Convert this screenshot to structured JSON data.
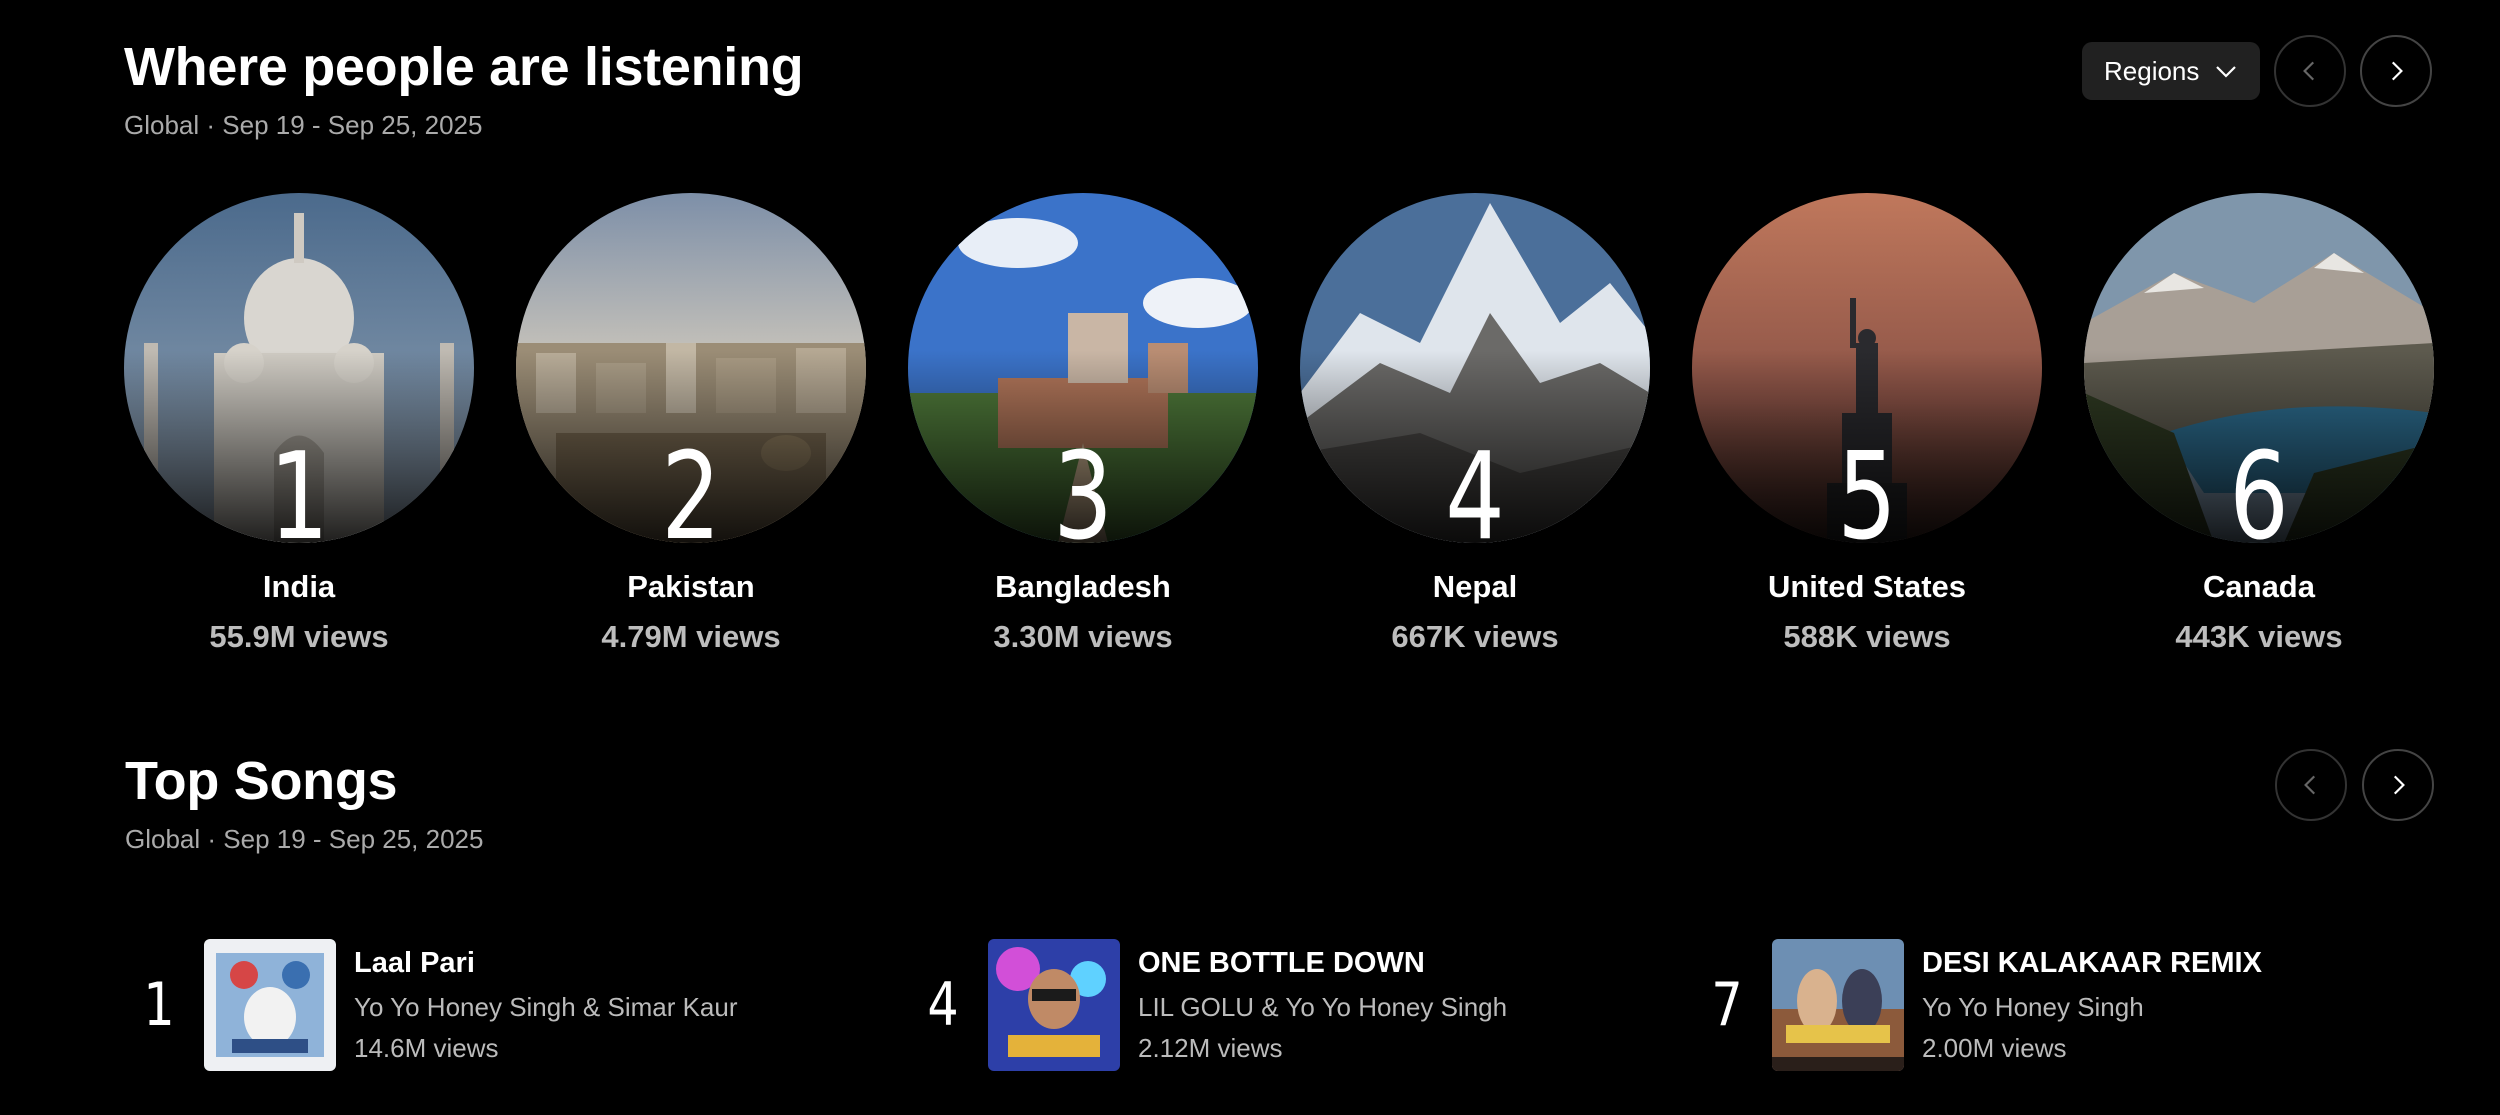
{
  "regions_section": {
    "title": "Where people are listening",
    "subtitle": "Global · Sep 19 - Sep 25, 2025",
    "dropdown_label": "Regions",
    "items": [
      {
        "rank": "1",
        "name": "India",
        "views": "55.9M views",
        "icon": "taj-mahal-photo"
      },
      {
        "rank": "2",
        "name": "Pakistan",
        "views": "4.79M views",
        "icon": "city-skyline-photo"
      },
      {
        "rank": "3",
        "name": "Bangladesh",
        "views": "3.30M views",
        "icon": "fort-photo"
      },
      {
        "rank": "4",
        "name": "Nepal",
        "views": "667K views",
        "icon": "mountain-photo"
      },
      {
        "rank": "5",
        "name": "United States",
        "views": "588K views",
        "icon": "statue-of-liberty-photo"
      },
      {
        "rank": "6",
        "name": "Canada",
        "views": "443K views",
        "icon": "lake-mountains-photo"
      }
    ]
  },
  "songs_section": {
    "title": "Top Songs",
    "subtitle": "Global · Sep 19 - Sep 25, 2025",
    "items": [
      {
        "rank": "1",
        "title": "Laal Pari",
        "artist": "Yo Yo Honey Singh & Simar Kaur",
        "views": "14.6M views"
      },
      {
        "rank": "4",
        "title": "ONE BOTTLE DOWN",
        "artist": "LIL GOLU & Yo Yo Honey Singh",
        "views": "2.12M views"
      },
      {
        "rank": "7",
        "title": "DESI KALAKAAR REMIX",
        "artist": "Yo Yo Honey Singh",
        "views": "2.00M views"
      }
    ]
  },
  "colors": {
    "background": "#000000",
    "button_bg": "#212121",
    "muted_text": "#aaaaaa"
  }
}
